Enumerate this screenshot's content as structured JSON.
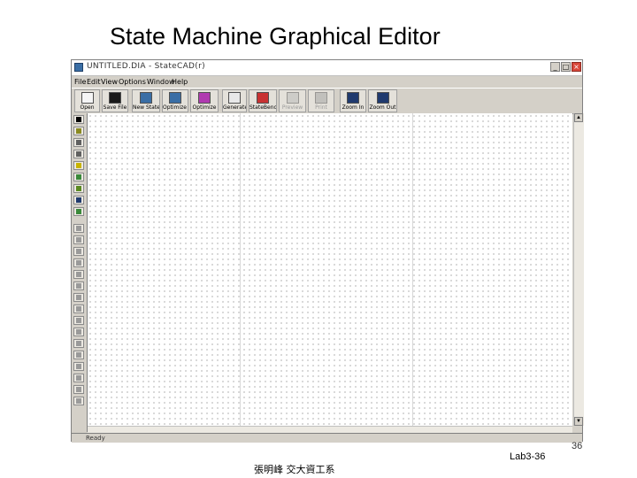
{
  "slide": {
    "title": "State Machine Graphical Editor",
    "page_number": "36",
    "footer_left": "張明峰 交大資工系",
    "footer_right": "Lab3-36"
  },
  "window": {
    "title": "UNTITLED.DIA - StateCAD(r)",
    "minimize_glyph": "_",
    "maximize_glyph": "□",
    "close_glyph": "×"
  },
  "menu": [
    "File",
    "Edit",
    "View",
    "Options",
    "Window",
    "Help"
  ],
  "toolbar": [
    {
      "label": "Open",
      "icon": "open-file-icon",
      "disabled": false
    },
    {
      "label": "Save File",
      "icon": "save-disk-icon",
      "disabled": false
    },
    {
      "label": "New State Machine",
      "icon": "new-state-machine-icon",
      "disabled": false
    },
    {
      "label": "Optimize Logic",
      "icon": "optimize-logic-icon",
      "disabled": false
    },
    {
      "label": "Optimize",
      "icon": "optimize-icon",
      "disabled": false
    },
    {
      "label": "Generate HDL",
      "icon": "generate-hdl-icon",
      "disabled": false
    },
    {
      "label": "StateBench",
      "icon": "statebench-icon",
      "disabled": false
    },
    {
      "label": "Preview",
      "icon": "print-preview-icon",
      "disabled": true
    },
    {
      "label": "Print",
      "icon": "printer-icon",
      "disabled": true
    },
    {
      "label": "Zoom In",
      "icon": "zoom-in-icon",
      "disabled": false
    },
    {
      "label": "Zoom Out",
      "icon": "zoom-out-icon",
      "disabled": false
    }
  ],
  "palette": [
    {
      "icon": "pointer-icon",
      "color": "#000000"
    },
    {
      "icon": "state-icon",
      "color": "#8a8a20"
    },
    {
      "icon": "transition-icon",
      "color": "#606060"
    },
    {
      "icon": "dotted-transition-icon",
      "color": "#606060"
    },
    {
      "icon": "text-box-icon",
      "color": "#c8b400"
    },
    {
      "icon": "reset-icon",
      "color": "#3a8a3a"
    },
    {
      "icon": "output-icon",
      "color": "#5a8a20"
    },
    {
      "icon": "machine-icon",
      "color": "#203a6e"
    },
    {
      "icon": "input-icon",
      "color": "#3a8a3a"
    },
    {
      "icon": "tool-10-icon",
      "color": "#9a9a9a"
    },
    {
      "icon": "tool-11-icon",
      "color": "#9a9a9a"
    },
    {
      "icon": "tool-12-icon",
      "color": "#9a9a9a"
    },
    {
      "icon": "tool-13-icon",
      "color": "#9a9a9a"
    },
    {
      "icon": "tool-14-icon",
      "color": "#9a9a9a"
    },
    {
      "icon": "tool-15-icon",
      "color": "#9a9a9a"
    },
    {
      "icon": "tool-16-icon",
      "color": "#9a9a9a"
    },
    {
      "icon": "tool-17-icon",
      "color": "#9a9a9a"
    },
    {
      "icon": "tool-18-icon",
      "color": "#9a9a9a"
    },
    {
      "icon": "tool-19-icon",
      "color": "#9a9a9a"
    },
    {
      "icon": "tool-20-icon",
      "color": "#9a9a9a"
    },
    {
      "icon": "tool-21-icon",
      "color": "#9a9a9a"
    },
    {
      "icon": "tool-22-icon",
      "color": "#9a9a9a"
    },
    {
      "icon": "tool-23-icon",
      "color": "#9a9a9a"
    },
    {
      "icon": "tool-24-icon",
      "color": "#9a9a9a"
    },
    {
      "icon": "tool-25-icon",
      "color": "#9a9a9a"
    }
  ],
  "scroll": {
    "up_glyph": "▲",
    "down_glyph": "▼"
  },
  "status": {
    "text": "Ready"
  }
}
